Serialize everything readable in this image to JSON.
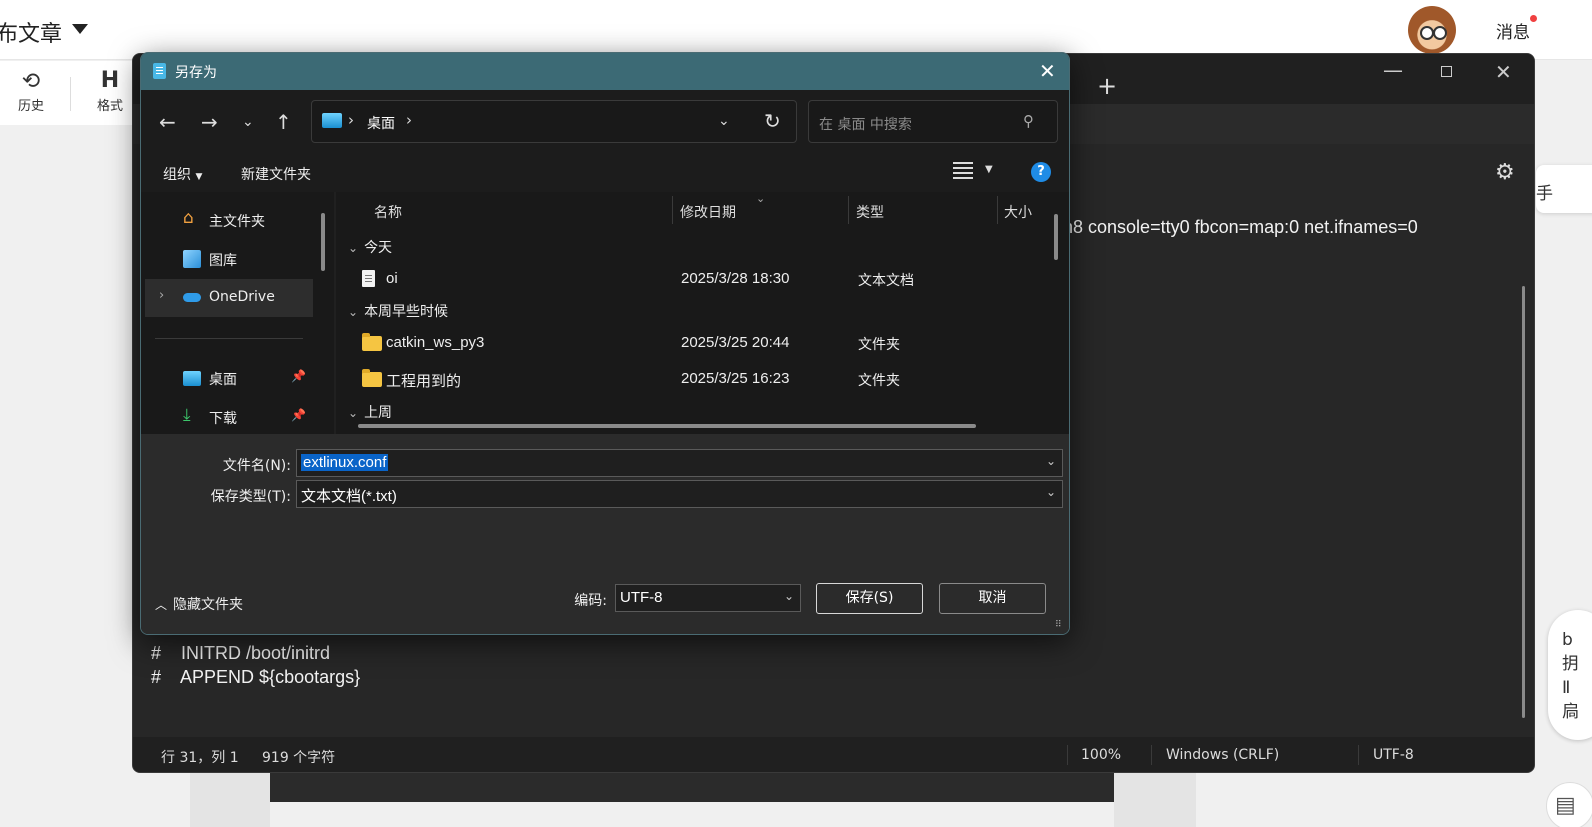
{
  "background_page": {
    "title": "布文章",
    "toolbar": {
      "history": "历史",
      "format": "格式",
      "format_icon": "H"
    },
    "header": {
      "messages": "消息"
    },
    "right_chip": "手",
    "right_pill": [
      "b",
      "抈",
      "Ⅱ",
      "扃"
    ]
  },
  "notepad": {
    "text_line_partial": "n8 console=tty0 fbcon=map:0 net.ifnames=0",
    "lines": [
      "#    INITRD /boot/initrd",
      "#    APPEND ${cbootargs}"
    ],
    "status": {
      "position": "行 31，列 1",
      "chars": "919 个字符",
      "zoom": "100%",
      "line_ending": "Windows (CRLF)",
      "encoding": "UTF-8"
    }
  },
  "dialog": {
    "title": "另存为",
    "address": {
      "segment": "桌面"
    },
    "search_placeholder": "在 桌面 中搜索",
    "commands": {
      "organize": "组织",
      "new_folder": "新建文件夹"
    },
    "nav_items": [
      {
        "label": "主文件夹",
        "icon": "home-icon"
      },
      {
        "label": "图库",
        "icon": "gallery-icon"
      },
      {
        "label": "OneDrive",
        "icon": "onedrive-icon"
      },
      {
        "label": "桌面",
        "icon": "desktop-icon"
      },
      {
        "label": "下载",
        "icon": "download-icon"
      }
    ],
    "columns": {
      "name": "名称",
      "modified": "修改日期",
      "type": "类型",
      "size": "大小"
    },
    "groups": [
      {
        "label": "今天",
        "files": [
          {
            "name": "oi",
            "date": "2025/3/28 18:30",
            "type": "文本文档",
            "icon": "text-file-icon"
          }
        ]
      },
      {
        "label": "本周早些时候",
        "files": [
          {
            "name": "catkin_ws_py3",
            "date": "2025/3/25 20:44",
            "type": "文件夹",
            "icon": "folder-icon"
          },
          {
            "name": "工程用到的",
            "date": "2025/3/25 16:23",
            "type": "文件夹",
            "icon": "folder-icon"
          }
        ]
      },
      {
        "label": "上周",
        "files": []
      }
    ],
    "filename_label": "文件名(N):",
    "filename_value": "extlinux.conf",
    "filetype_label": "保存类型(T):",
    "filetype_value": "文本文档(*.txt)",
    "hide_folders": "隐藏文件夹",
    "encoding_label": "编码:",
    "encoding_value": "UTF-8",
    "save": "保存(S)",
    "cancel": "取消"
  }
}
